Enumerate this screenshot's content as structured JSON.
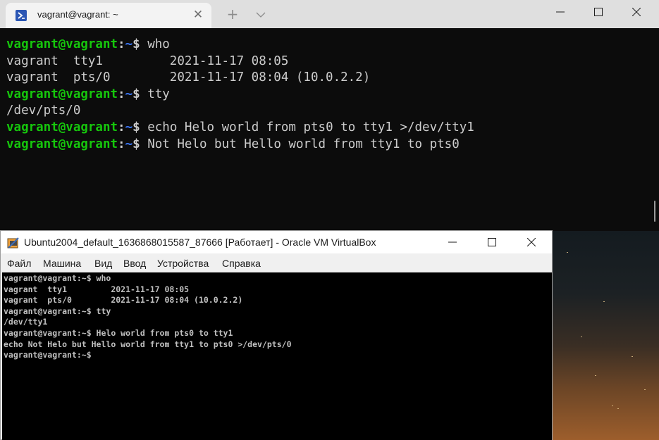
{
  "terminal": {
    "tab_title": "vagrant@vagrant: ~",
    "tab_close_glyph": "✕",
    "new_tab_glyph": "+",
    "icons": {
      "tab": "powershell-terminal-icon",
      "dropdown": "chevron-down-icon",
      "minimize": "minimize-icon",
      "maximize": "maximize-icon",
      "close": "close-icon"
    },
    "colors": {
      "background": "#0c0c0c",
      "prompt_user": "#16c60c",
      "prompt_path": "#3b78ff",
      "text": "#cccccc"
    },
    "prompt": {
      "user": "vagrant@vagrant",
      "colon": ":",
      "path": "~",
      "sign": "$"
    },
    "lines": [
      {
        "type": "prompt",
        "command": " who"
      },
      {
        "type": "output",
        "text": "vagrant  tty1         2021-11-17 08:05"
      },
      {
        "type": "output",
        "text": "vagrant  pts/0        2021-11-17 08:04 (10.0.2.2)"
      },
      {
        "type": "prompt",
        "command": " tty"
      },
      {
        "type": "output",
        "text": "/dev/pts/0"
      },
      {
        "type": "prompt",
        "command": " echo Helo world from pts0 to tty1 >/dev/tty1"
      },
      {
        "type": "prompt",
        "command": " Not Helo but Hello world from tty1 to pts0"
      }
    ]
  },
  "virtualbox": {
    "title": "Ubuntu2004_default_1636868015587_87666 [Работает] - Oracle VM VirtualBox",
    "icons": {
      "app": "virtualbox-icon",
      "minimize": "minimize-icon",
      "maximize": "maximize-icon",
      "close": "close-icon"
    },
    "menu": [
      "Файл",
      "Машина",
      "Вид",
      "Ввод",
      "Устройства",
      "Справка"
    ],
    "console_lines": [
      "vagrant@vagrant:~$ who",
      "vagrant  tty1         2021-11-17 08:05",
      "vagrant  pts/0        2021-11-17 08:04 (10.0.2.2)",
      "vagrant@vagrant:~$ tty",
      "/dev/tty1",
      "vagrant@vagrant:~$ Helo world from pts0 to tty1",
      "echo Not Helo but Hello world from tty1 to pts0 >/dev/pts/0",
      "vagrant@vagrant:~$"
    ]
  }
}
